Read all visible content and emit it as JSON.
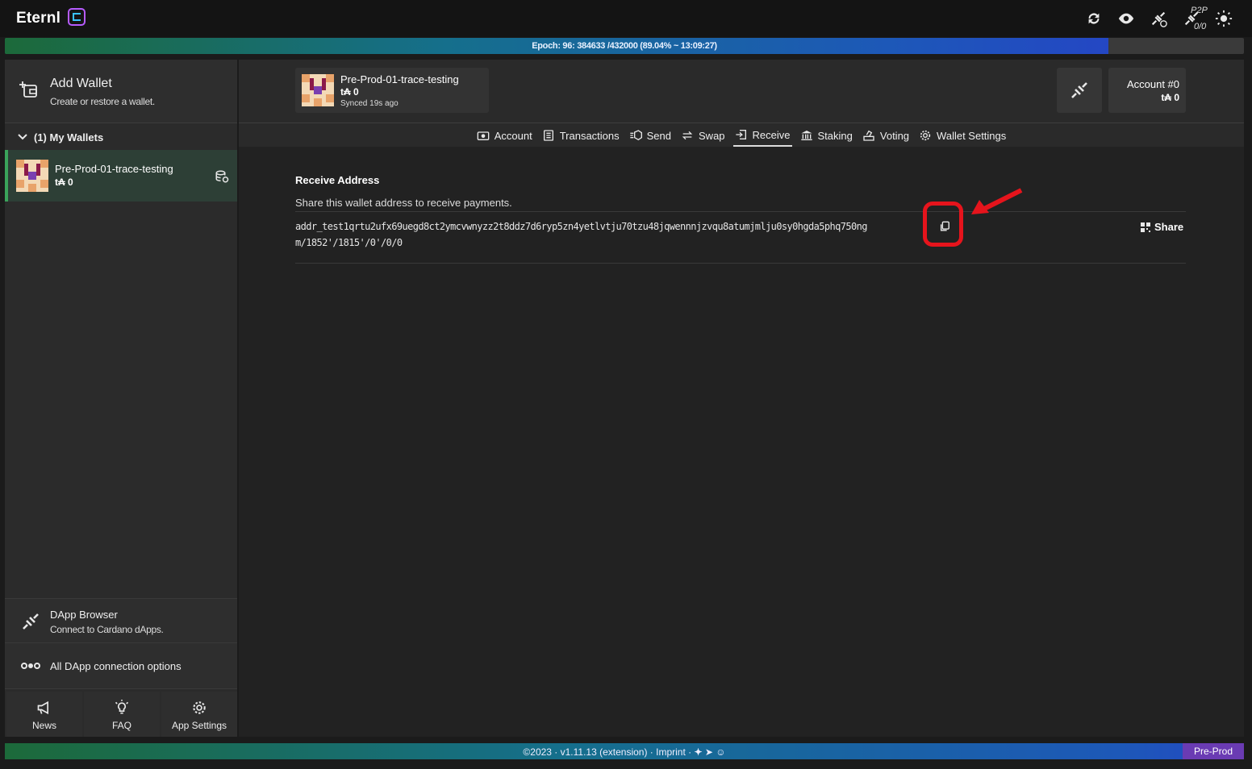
{
  "app": {
    "name": "Eternl"
  },
  "topbar": {
    "p2p_label": "P2P",
    "p2p_count": "0/0"
  },
  "epoch": {
    "text": "Epoch: 96: 384633 /432000 (89.04% ~ 13:09:27)",
    "progress_percent": 89.04
  },
  "sidebar": {
    "add_wallet_title": "Add Wallet",
    "add_wallet_subtitle": "Create or restore a wallet.",
    "my_wallets_label": "(1) My Wallets",
    "wallet": {
      "name": "Pre-Prod-01-trace-testing",
      "balance": "t₳ 0"
    },
    "dapp_browser_title": "DApp Browser",
    "dapp_browser_subtitle": "Connect to Cardano dApps.",
    "all_dapp_label": "All DApp connection options",
    "bottom": [
      {
        "label": "News"
      },
      {
        "label": "FAQ"
      },
      {
        "label": "App Settings"
      }
    ]
  },
  "header": {
    "wallet_name": "Pre-Prod-01-trace-testing",
    "wallet_balance": "t₳ 0",
    "sync_status": "Synced 19s ago",
    "account_name": "Account #0",
    "account_balance": "t₳ 0"
  },
  "tabs": [
    {
      "label": "Account",
      "icon": "camera-icon"
    },
    {
      "label": "Transactions",
      "icon": "list-icon"
    },
    {
      "label": "Send",
      "icon": "send-icon"
    },
    {
      "label": "Swap",
      "icon": "swap-icon"
    },
    {
      "label": "Receive",
      "icon": "receive-icon",
      "active": true
    },
    {
      "label": "Staking",
      "icon": "bank-icon"
    },
    {
      "label": "Voting",
      "icon": "vote-icon"
    },
    {
      "label": "Wallet Settings",
      "icon": "gear-icon"
    }
  ],
  "receive": {
    "title": "Receive Address",
    "subtitle": "Share this wallet address to receive payments.",
    "address": "addr_test1qrtu2ufx69uegd8ct2ymcvwnyzz2t8ddz7d6ryp5zn4yetlvtju70tzu48jqwennnjzvqu8atumjmlju0sy0hgda5phq750ng",
    "derivation_path": "m/1852'/1815'/0'/0/0",
    "share_label": "Share"
  },
  "footer": {
    "text": "©2023 · v1.11.13 (extension) · Imprint ·",
    "network": "Pre-Prod"
  },
  "colors": {
    "accent_green": "#3aa35a",
    "highlight_red": "#e6141c",
    "network_purple": "#6a3bb3"
  }
}
